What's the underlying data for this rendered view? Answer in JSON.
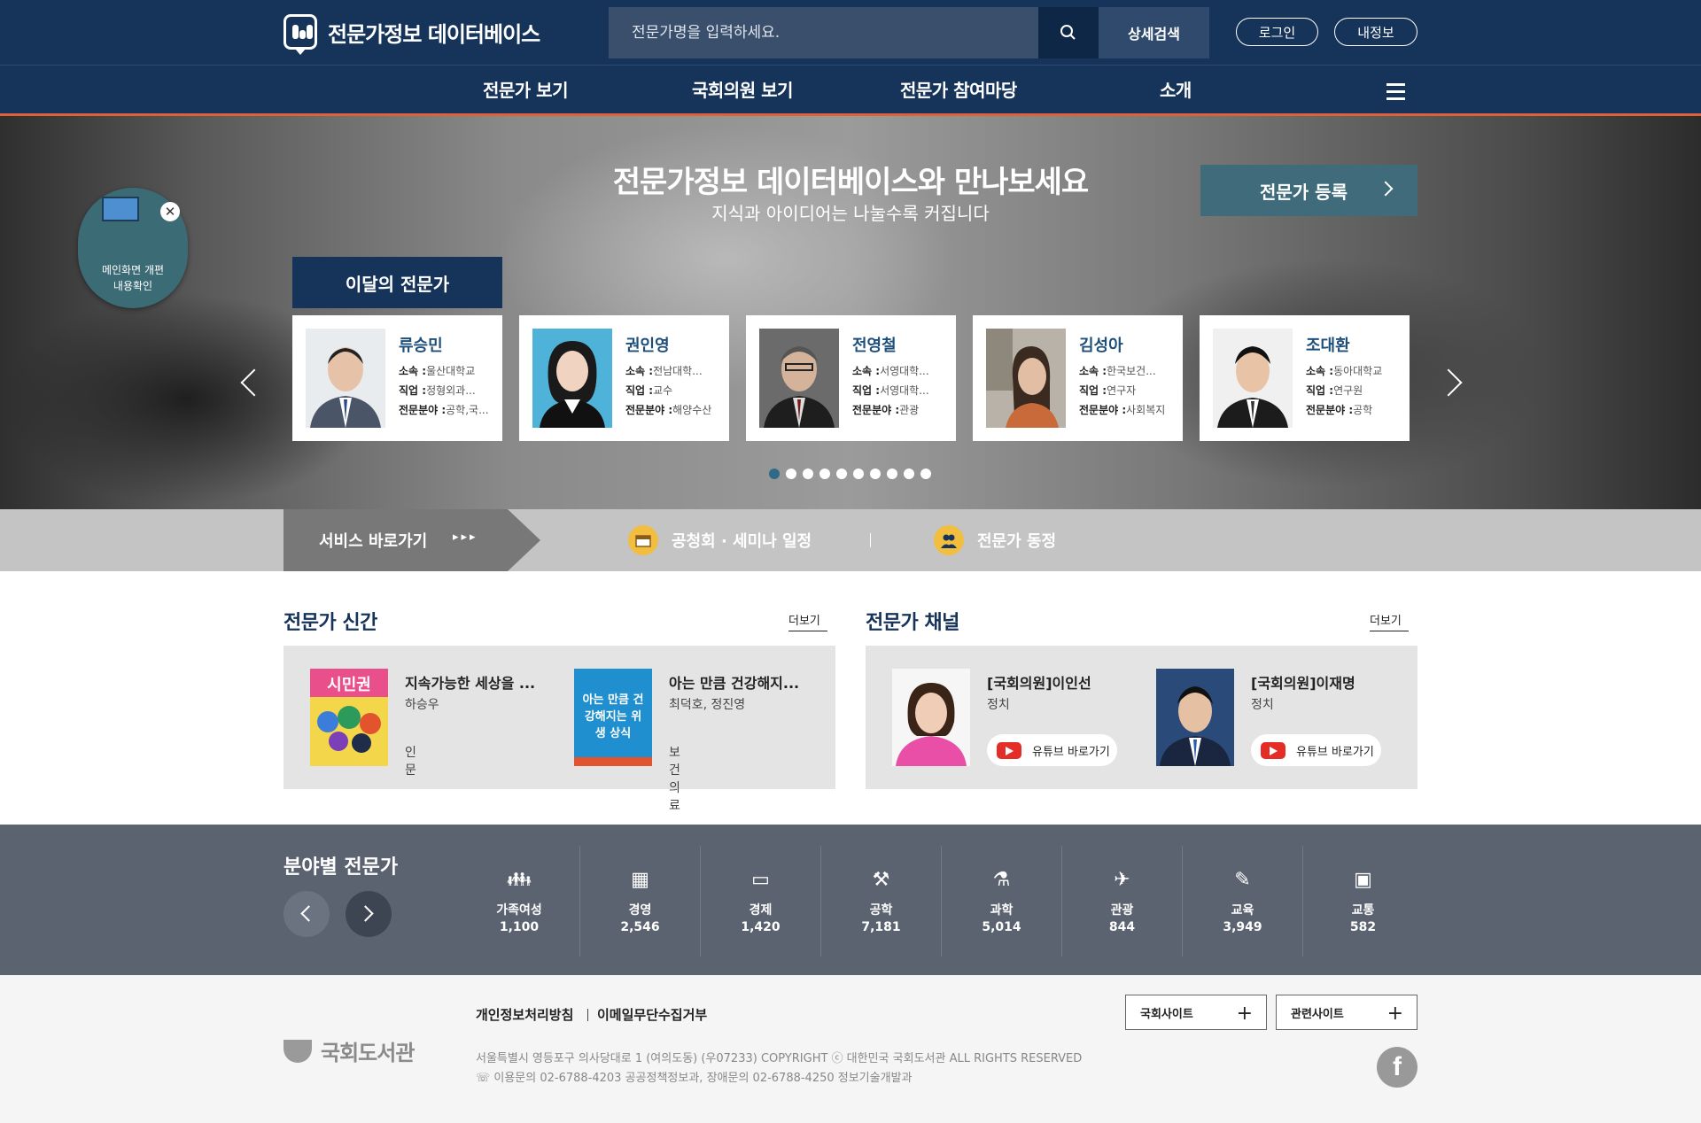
{
  "header": {
    "site_title": "전문가정보 데이터베이스",
    "search_placeholder": "전문가명을 입력하세요.",
    "advanced_search": "상세검색",
    "login": "로그인",
    "my_info": "내정보",
    "nav": [
      "전문가 보기",
      "국회의원 보기",
      "전문가 참여마당",
      "소개"
    ]
  },
  "hero": {
    "title": "전문가정보 데이터베이스와 만나보세요",
    "subtitle": "지식과 아이디어는 나눌수록 커집니다",
    "register_button": "전문가 등록",
    "month_tab": "이달의 전문가",
    "cards": [
      {
        "name": "류승민",
        "affiliation": "울산대학교",
        "job": "정형외과...",
        "field": "공학,국..."
      },
      {
        "name": "권인영",
        "affiliation": "전남대학...",
        "job": "교수",
        "field": "해양수산"
      },
      {
        "name": "전영철",
        "affiliation": "서영대학...",
        "job": "서영대학...",
        "field": "관광"
      },
      {
        "name": "김성아",
        "affiliation": "한국보건...",
        "job": "연구자",
        "field": "사회복지"
      },
      {
        "name": "조대환",
        "affiliation": "동아대학교",
        "job": "연구원",
        "field": "공학"
      }
    ],
    "labels": {
      "affiliation": "소속 :",
      "job": "직업 :",
      "field": "전문분야 :"
    },
    "floating_banner": {
      "line1": "메인화면 개편",
      "line2": "내용확인"
    }
  },
  "service_bar": {
    "label": "서비스 바로가기",
    "items": [
      "공청회 · 세미나 일정",
      "전문가 동정"
    ]
  },
  "new_books": {
    "title": "전문가 신간",
    "more": "더보기",
    "items": [
      {
        "title": "지속가능한 세상을 ...",
        "author": "하승우",
        "category": "인문",
        "cover_text": "시민권"
      },
      {
        "title": "아는 만큼 건강해지...",
        "author": "최덕호, 정진영",
        "category": "보건의료",
        "cover_text": "아는 만큼 건강해지는 위생 상식"
      }
    ]
  },
  "channel": {
    "title": "전문가 채널",
    "more": "더보기",
    "items": [
      {
        "name": "[국회의원]이인선",
        "field": "정치",
        "button": "유튜브 바로가기"
      },
      {
        "name": "[국회의원]이재명",
        "field": "정치",
        "button": "유튜브 바로가기"
      }
    ]
  },
  "fields": {
    "title": "분야별 전문가",
    "items": [
      {
        "label": "가족여성",
        "count": "1,100",
        "icon": "family-icon"
      },
      {
        "label": "경영",
        "count": "2,546",
        "icon": "building-icon"
      },
      {
        "label": "경제",
        "count": "1,420",
        "icon": "wallet-icon"
      },
      {
        "label": "공학",
        "count": "7,181",
        "icon": "crane-icon"
      },
      {
        "label": "과학",
        "count": "5,014",
        "icon": "flask-icon"
      },
      {
        "label": "관광",
        "count": "844",
        "icon": "airplane-icon"
      },
      {
        "label": "교육",
        "count": "3,949",
        "icon": "board-icon"
      },
      {
        "label": "교통",
        "count": "582",
        "icon": "bus-icon"
      }
    ]
  },
  "footer": {
    "logo_text": "국회도서관",
    "links": [
      "개인정보처리방침",
      "이메일무단수집거부"
    ],
    "address": "서울특별시 영등포구 의사당대로 1 (여의도동) (우07233) COPYRIGHT ⓒ 대한민국 국회도서관 ALL RIGHTS RESERVED",
    "contact": "☏ 이용문의 02-6788-4203 공공정책정보과, 장애문의 02-6788-4250 정보기술개발과",
    "site_buttons": [
      "국회사이트",
      "관련사이트"
    ],
    "facebook": "f"
  },
  "colors": {
    "header_bg": "#163359",
    "accent": "#e0603c",
    "register_button": "#3f6b7a",
    "field_band": "#5b6370",
    "service_icon": "#f2be40"
  }
}
